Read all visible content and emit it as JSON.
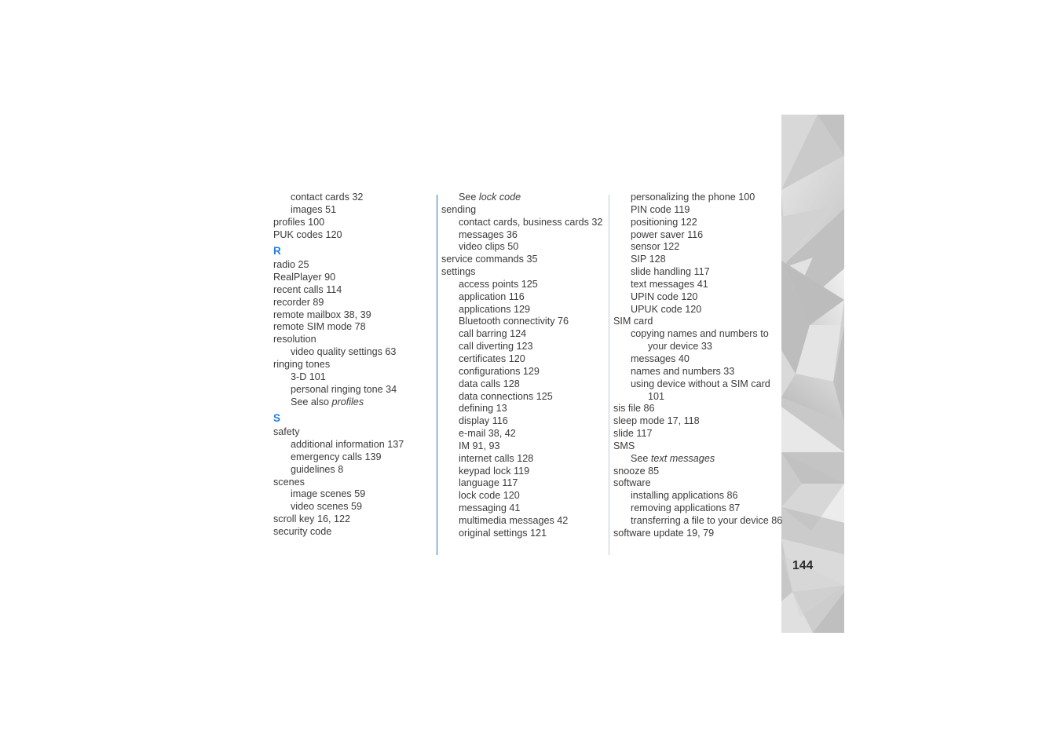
{
  "page": {
    "number": "144",
    "accent_blue": "#1f7fe0",
    "rule_blue": "#2f6fb5",
    "rule_light": "#b9cbe0",
    "text_color": "#3b3b3b",
    "background": "#ffffff"
  },
  "columns": [
    {
      "name": "column-1",
      "entries": [
        {
          "level": 1,
          "text": "contact cards  32"
        },
        {
          "level": 1,
          "text": "images  51"
        },
        {
          "level": 0,
          "text": "profiles  100"
        },
        {
          "level": 0,
          "text": "PUK codes  120"
        },
        {
          "level": 0,
          "text": "R",
          "type": "letter-heading"
        },
        {
          "level": 0,
          "text": "radio  25"
        },
        {
          "level": 0,
          "text": "RealPlayer  90"
        },
        {
          "level": 0,
          "text": "recent calls  114"
        },
        {
          "level": 0,
          "text": "recorder  89"
        },
        {
          "level": 0,
          "text": "remote mailbox  38, 39"
        },
        {
          "level": 0,
          "text": "remote SIM mode  78"
        },
        {
          "level": 0,
          "text": "resolution"
        },
        {
          "level": 1,
          "text": "video quality settings  63"
        },
        {
          "level": 0,
          "text": "ringing tones"
        },
        {
          "level": 1,
          "text": "3-D  101"
        },
        {
          "level": 1,
          "text": "personal ringing tone  34"
        },
        {
          "level": 1,
          "text": "See also ",
          "italic": "profiles"
        },
        {
          "level": 0,
          "text": "S",
          "type": "letter-heading"
        },
        {
          "level": 0,
          "text": "safety"
        },
        {
          "level": 1,
          "text": "additional information  137"
        },
        {
          "level": 1,
          "text": "emergency calls  139"
        },
        {
          "level": 1,
          "text": "guidelines  8"
        },
        {
          "level": 0,
          "text": "scenes"
        },
        {
          "level": 1,
          "text": "image scenes  59"
        },
        {
          "level": 1,
          "text": "video scenes  59"
        },
        {
          "level": 0,
          "text": "scroll key  16, 122"
        },
        {
          "level": 0,
          "text": "security code"
        }
      ]
    },
    {
      "name": "column-2",
      "entries": [
        {
          "level": 1,
          "text": "See ",
          "italic": "lock code"
        },
        {
          "level": 0,
          "text": "sending"
        },
        {
          "level": 1,
          "text": "contact cards, business cards  32"
        },
        {
          "level": 1,
          "text": "messages  36"
        },
        {
          "level": 1,
          "text": "video clips  50"
        },
        {
          "level": 0,
          "text": "service commands  35"
        },
        {
          "level": 0,
          "text": "settings"
        },
        {
          "level": 1,
          "text": "access points  125"
        },
        {
          "level": 1,
          "text": "application  116"
        },
        {
          "level": 1,
          "text": "applications  129"
        },
        {
          "level": 1,
          "text": "Bluetooth connectivity  76"
        },
        {
          "level": 1,
          "text": "call barring  124"
        },
        {
          "level": 1,
          "text": "call diverting  123"
        },
        {
          "level": 1,
          "text": "certificates  120"
        },
        {
          "level": 1,
          "text": "configurations  129"
        },
        {
          "level": 1,
          "text": "data calls  128"
        },
        {
          "level": 1,
          "text": "data connections  125"
        },
        {
          "level": 1,
          "text": "defining  13"
        },
        {
          "level": 1,
          "text": "display  116"
        },
        {
          "level": 1,
          "text": "e-mail  38, 42"
        },
        {
          "level": 1,
          "text": "IM  91, 93"
        },
        {
          "level": 1,
          "text": "internet calls  128"
        },
        {
          "level": 1,
          "text": "keypad lock  119"
        },
        {
          "level": 1,
          "text": "language  117"
        },
        {
          "level": 1,
          "text": "lock code  120"
        },
        {
          "level": 1,
          "text": "messaging  41"
        },
        {
          "level": 1,
          "text": "multimedia messages  42"
        },
        {
          "level": 1,
          "text": "original settings  121"
        }
      ]
    },
    {
      "name": "column-3",
      "entries": [
        {
          "level": 1,
          "text": "personalizing the phone  100"
        },
        {
          "level": 1,
          "text": "PIN code  119"
        },
        {
          "level": 1,
          "text": "positioning  122"
        },
        {
          "level": 1,
          "text": "power saver  116"
        },
        {
          "level": 1,
          "text": "sensor  122"
        },
        {
          "level": 1,
          "text": "SIP  128"
        },
        {
          "level": 1,
          "text": "slide handling  117"
        },
        {
          "level": 1,
          "text": "text messages  41"
        },
        {
          "level": 1,
          "text": "UPIN code  120"
        },
        {
          "level": 1,
          "text": "UPUK code  120"
        },
        {
          "level": 0,
          "text": "SIM card"
        },
        {
          "level": 1,
          "text": "copying names and numbers to"
        },
        {
          "level": 2,
          "text": "your device  33"
        },
        {
          "level": 1,
          "text": "messages  40"
        },
        {
          "level": 1,
          "text": "names and numbers  33"
        },
        {
          "level": 1,
          "text": "using device without a SIM card"
        },
        {
          "level": 2,
          "text": "101"
        },
        {
          "level": 0,
          "text": "sis file  86"
        },
        {
          "level": 0,
          "text": "sleep mode  17, 118"
        },
        {
          "level": 0,
          "text": "slide  117"
        },
        {
          "level": 0,
          "text": "SMS"
        },
        {
          "level": 1,
          "text": "See ",
          "italic": "text messages"
        },
        {
          "level": 0,
          "text": "snooze  85"
        },
        {
          "level": 0,
          "text": "software"
        },
        {
          "level": 1,
          "text": "installing applications  86"
        },
        {
          "level": 1,
          "text": "removing applications  87"
        },
        {
          "level": 1,
          "text": "transferring a file to your device  86"
        },
        {
          "level": 0,
          "text": "software update  19, 79"
        }
      ]
    }
  ]
}
